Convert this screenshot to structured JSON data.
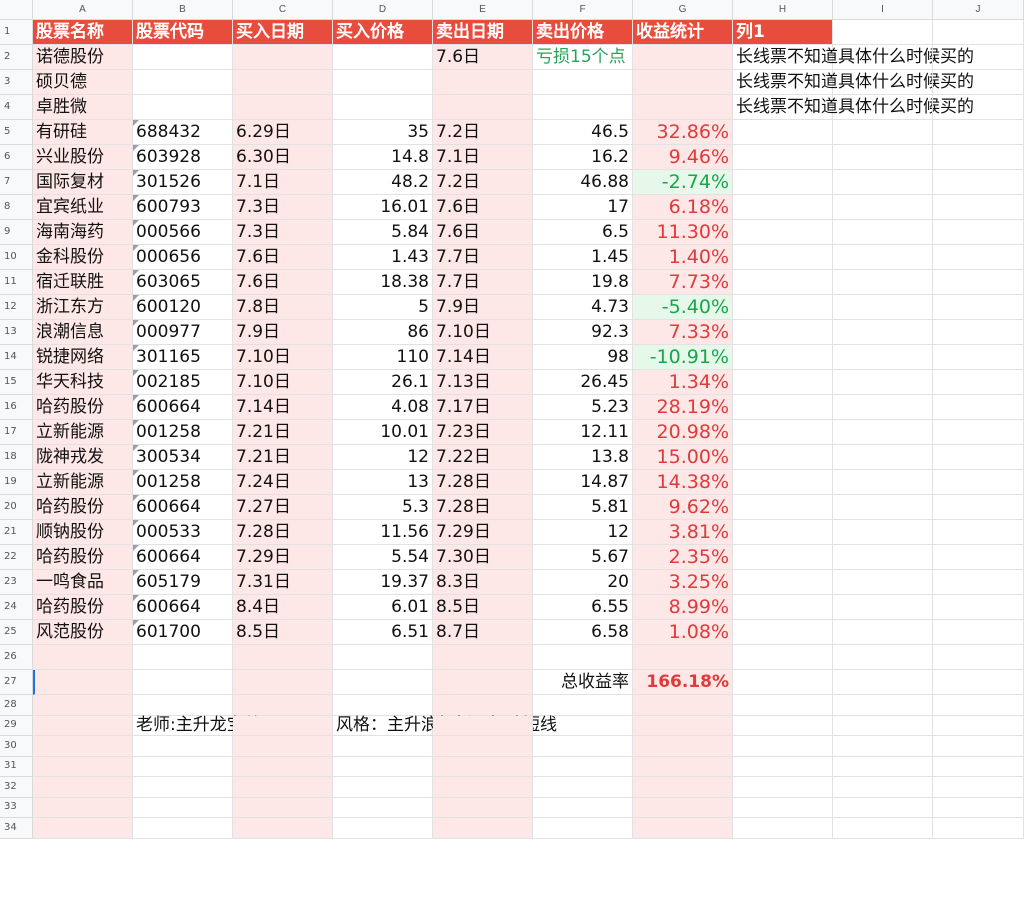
{
  "columns": [
    "A",
    "B",
    "C",
    "D",
    "E",
    "F",
    "G",
    "H",
    "I",
    "J"
  ],
  "header": {
    "name": "股票名称",
    "code": "股票代码",
    "buy_date": "买入日期",
    "buy_price": "买入价格",
    "sell_date": "卖出日期",
    "sell_price": "卖出价格",
    "stats": "收益统计",
    "col1": "列1"
  },
  "pre_rows": [
    {
      "row": "2",
      "name": "诺德股份",
      "code": "",
      "buy_date": "",
      "buy_price": "",
      "sell_date": "7.6日",
      "sell_price": "亏损15个点",
      "stats": "",
      "note": "长线票不知道具体什么时候买的"
    },
    {
      "row": "3",
      "name": "硕贝德",
      "code": "",
      "buy_date": "",
      "buy_price": "",
      "sell_date": "",
      "sell_price": "",
      "stats": "",
      "note": "长线票不知道具体什么时候买的"
    },
    {
      "row": "4",
      "name": "卓胜微",
      "code": "",
      "buy_date": "",
      "buy_price": "",
      "sell_date": "",
      "sell_price": "",
      "stats": "",
      "note": "长线票不知道具体什么时候买的"
    }
  ],
  "trades": [
    {
      "row": "5",
      "name": "有研硅",
      "code": "688432",
      "buy_date": "6.29日",
      "buy_price": "35",
      "sell_date": "7.2日",
      "sell_price": "46.5",
      "ret": "32.86%",
      "loss": false
    },
    {
      "row": "6",
      "name": "兴业股份",
      "code": "603928",
      "buy_date": "6.30日",
      "buy_price": "14.8",
      "sell_date": "7.1日",
      "sell_price": "16.2",
      "ret": "9.46%",
      "loss": false
    },
    {
      "row": "7",
      "name": "国际复材",
      "code": "301526",
      "buy_date": "7.1日",
      "buy_price": "48.2",
      "sell_date": "7.2日",
      "sell_price": "46.88",
      "ret": "-2.74%",
      "loss": true
    },
    {
      "row": "8",
      "name": "宜宾纸业",
      "code": "600793",
      "buy_date": "7.3日",
      "buy_price": "16.01",
      "sell_date": "7.6日",
      "sell_price": "17",
      "ret": "6.18%",
      "loss": false
    },
    {
      "row": "9",
      "name": "海南海药",
      "code": "000566",
      "buy_date": "7.3日",
      "buy_price": "5.84",
      "sell_date": "7.6日",
      "sell_price": "6.5",
      "ret": "11.30%",
      "loss": false
    },
    {
      "row": "10",
      "name": "金科股份",
      "code": "000656",
      "buy_date": "7.6日",
      "buy_price": "1.43",
      "sell_date": "7.7日",
      "sell_price": "1.45",
      "ret": "1.40%",
      "loss": false
    },
    {
      "row": "11",
      "name": "宿迁联胜",
      "code": "603065",
      "buy_date": "7.6日",
      "buy_price": "18.38",
      "sell_date": "7.7日",
      "sell_price": "19.8",
      "ret": "7.73%",
      "loss": false
    },
    {
      "row": "12",
      "name": "浙江东方",
      "code": "600120",
      "buy_date": "7.8日",
      "buy_price": "5",
      "sell_date": "7.9日",
      "sell_price": "4.73",
      "ret": "-5.40%",
      "loss": true
    },
    {
      "row": "13",
      "name": "浪潮信息",
      "code": "000977",
      "buy_date": "7.9日",
      "buy_price": "86",
      "sell_date": "7.10日",
      "sell_price": "92.3",
      "ret": "7.33%",
      "loss": false
    },
    {
      "row": "14",
      "name": "锐捷网络",
      "code": "301165",
      "buy_date": "7.10日",
      "buy_price": "110",
      "sell_date": "7.14日",
      "sell_price": "98",
      "ret": "-10.91%",
      "loss": true
    },
    {
      "row": "15",
      "name": "华天科技",
      "code": "002185",
      "buy_date": "7.10日",
      "buy_price": "26.1",
      "sell_date": "7.13日",
      "sell_price": "26.45",
      "ret": "1.34%",
      "loss": false
    },
    {
      "row": "16",
      "name": "哈药股份",
      "code": "600664",
      "buy_date": "7.14日",
      "buy_price": "4.08",
      "sell_date": "7.17日",
      "sell_price": "5.23",
      "ret": "28.19%",
      "loss": false
    },
    {
      "row": "17",
      "name": "立新能源",
      "code": "001258",
      "buy_date": "7.21日",
      "buy_price": "10.01",
      "sell_date": "7.23日",
      "sell_price": "12.11",
      "ret": "20.98%",
      "loss": false
    },
    {
      "row": "18",
      "name": "陇神戎发",
      "code": "300534",
      "buy_date": "7.21日",
      "buy_price": "12",
      "sell_date": "7.22日",
      "sell_price": "13.8",
      "ret": "15.00%",
      "loss": false
    },
    {
      "row": "19",
      "name": "立新能源",
      "code": "001258",
      "buy_date": "7.24日",
      "buy_price": "13",
      "sell_date": "7.28日",
      "sell_price": "14.87",
      "ret": "14.38%",
      "loss": false
    },
    {
      "row": "20",
      "name": "哈药股份",
      "code": "600664",
      "buy_date": "7.27日",
      "buy_price": "5.3",
      "sell_date": "7.28日",
      "sell_price": "5.81",
      "ret": "9.62%",
      "loss": false
    },
    {
      "row": "21",
      "name": "顺钠股份",
      "code": "000533",
      "buy_date": "7.28日",
      "buy_price": "11.56",
      "sell_date": "7.29日",
      "sell_price": "12",
      "ret": "3.81%",
      "loss": false
    },
    {
      "row": "22",
      "name": "哈药股份",
      "code": "600664",
      "buy_date": "7.29日",
      "buy_price": "5.54",
      "sell_date": "7.30日",
      "sell_price": "5.67",
      "ret": "2.35%",
      "loss": false
    },
    {
      "row": "23",
      "name": "一鸣食品",
      "code": "605179",
      "buy_date": "7.31日",
      "buy_price": "19.37",
      "sell_date": "8.3日",
      "sell_price": "20",
      "ret": "3.25%",
      "loss": false
    },
    {
      "row": "24",
      "name": "哈药股份",
      "code": "600664",
      "buy_date": "8.4日",
      "buy_price": "6.01",
      "sell_date": "8.5日",
      "sell_price": "6.55",
      "ret": "8.99%",
      "loss": false
    },
    {
      "row": "25",
      "name": "风范股份",
      "code": "601700",
      "buy_date": "8.5日",
      "buy_price": "6.51",
      "sell_date": "8.7日",
      "sell_price": "6.58",
      "ret": "1.08%",
      "loss": false
    }
  ],
  "summary": {
    "total_label": "总收益率",
    "total_value": "166.18%",
    "teacher": "老师:主升龙宝总",
    "style": "风格：主升浪打板，极致短线"
  },
  "empty_rows": [
    "26",
    "27",
    "28",
    "29",
    "30",
    "31",
    "32",
    "33",
    "34"
  ],
  "colors": {
    "header_red": "#e74c3c",
    "pink_fill": "#fde7e7",
    "gain_red": "#e03a3a",
    "loss_green": "#19a64b"
  }
}
